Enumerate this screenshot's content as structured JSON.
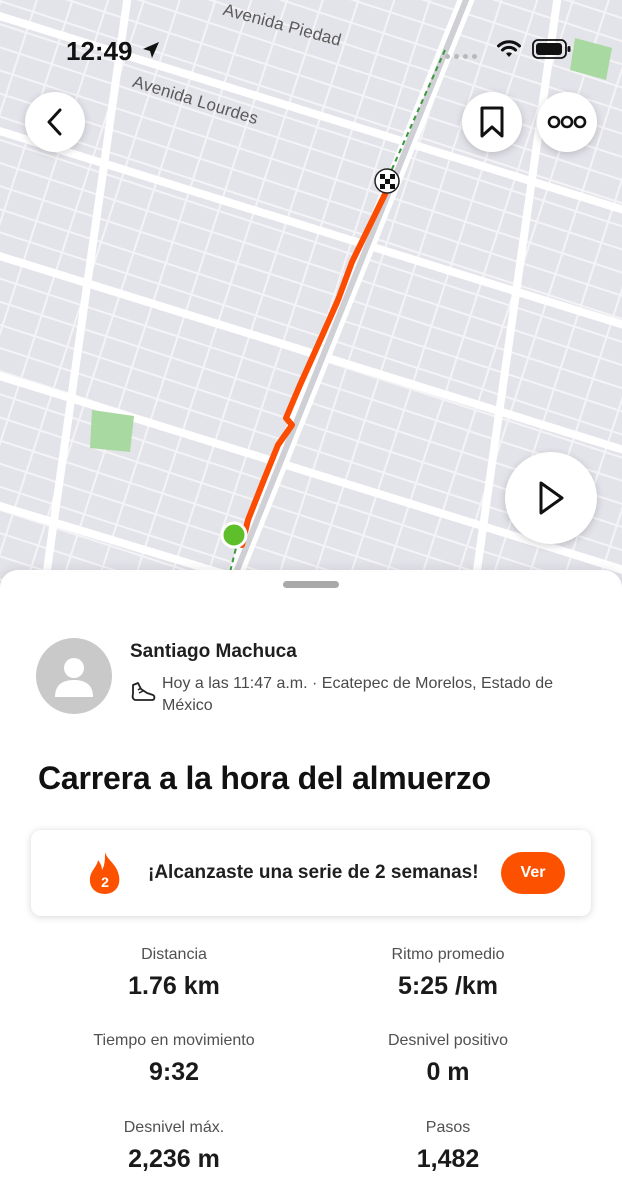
{
  "status_bar": {
    "time": "12:49"
  },
  "map": {
    "street_labels": [
      "Avenida Piedad",
      "Avenida Lourdes"
    ],
    "route_color": "#fc4c02",
    "start_color": "#5fbf2a"
  },
  "icons": {
    "back": "chevron-left-icon",
    "bookmark": "bookmark-icon",
    "more": "more-options-icon",
    "play": "play-icon",
    "shoe": "running-shoe-icon",
    "flame": "flame-icon"
  },
  "athlete": {
    "name": "Santiago Machuca",
    "meta": "Hoy a las 11:47 a.m. · Ecatepec de Morelos, Estado de México"
  },
  "activity": {
    "title": "Carrera a la hora del almuerzo"
  },
  "streak": {
    "count": "2",
    "text": "¡Alcanzaste una serie de 2 semanas!",
    "button_label": "Ver",
    "accent": "#fc5200"
  },
  "stats": [
    {
      "label": "Distancia",
      "value": "1.76 km"
    },
    {
      "label": "Ritmo promedio",
      "value": "5:25 /km"
    },
    {
      "label": "Tiempo en movimiento",
      "value": "9:32"
    },
    {
      "label": "Desnivel positivo",
      "value": "0 m"
    },
    {
      "label": "Desnivel máx.",
      "value": "2,236 m"
    },
    {
      "label": "Pasos",
      "value": "1,482"
    }
  ]
}
